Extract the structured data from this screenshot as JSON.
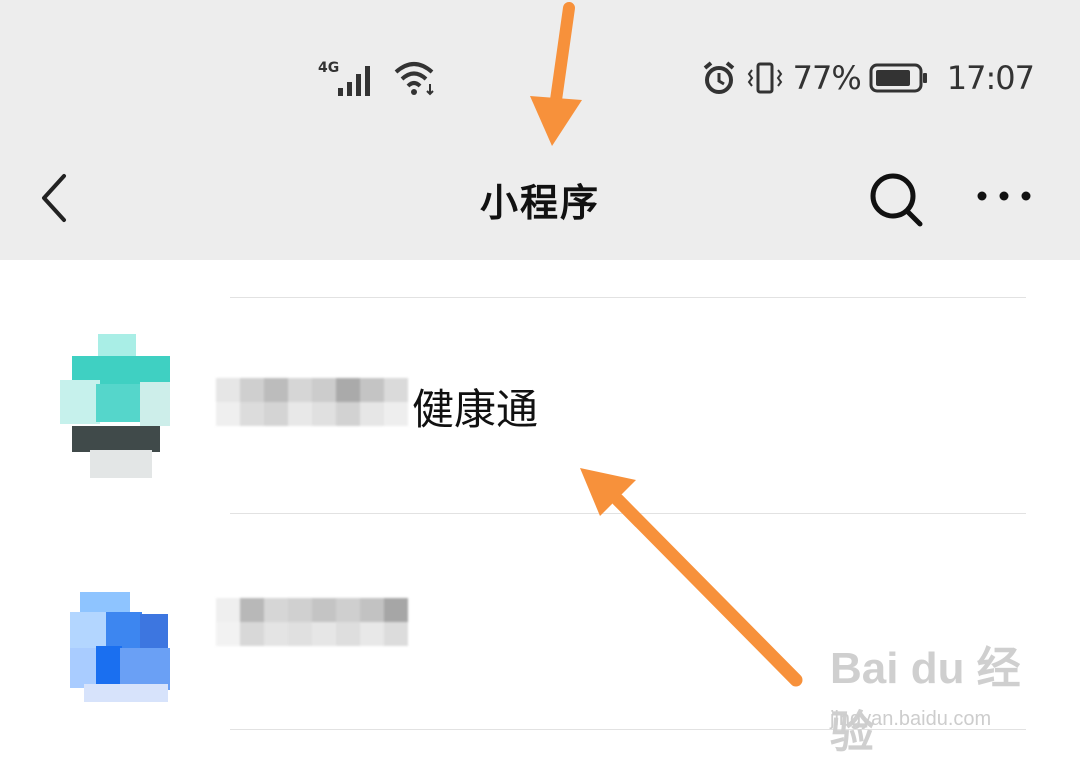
{
  "status_bar": {
    "network": "4G",
    "battery_percent": "77%",
    "time": "17:07",
    "icons": [
      "signal-icon",
      "wifi-icon",
      "alarm-icon",
      "vibrate-icon",
      "battery-icon"
    ]
  },
  "header": {
    "title": "小程序",
    "icons": [
      "back-icon",
      "search-icon",
      "more-icon"
    ]
  },
  "list": {
    "items": [
      {
        "name_visible": "健康通",
        "icon": "mini-program-icon"
      },
      {
        "name_visible": "",
        "icon": "mini-program-icon"
      }
    ]
  },
  "watermark": {
    "brand": "Bai du 经验",
    "url": "jingyan.baidu.com"
  },
  "colors": {
    "bar_bg": "#ededed",
    "arrow": "#f7913b",
    "icon1": "#3fcfc0",
    "icon2": "#3d86f0"
  }
}
